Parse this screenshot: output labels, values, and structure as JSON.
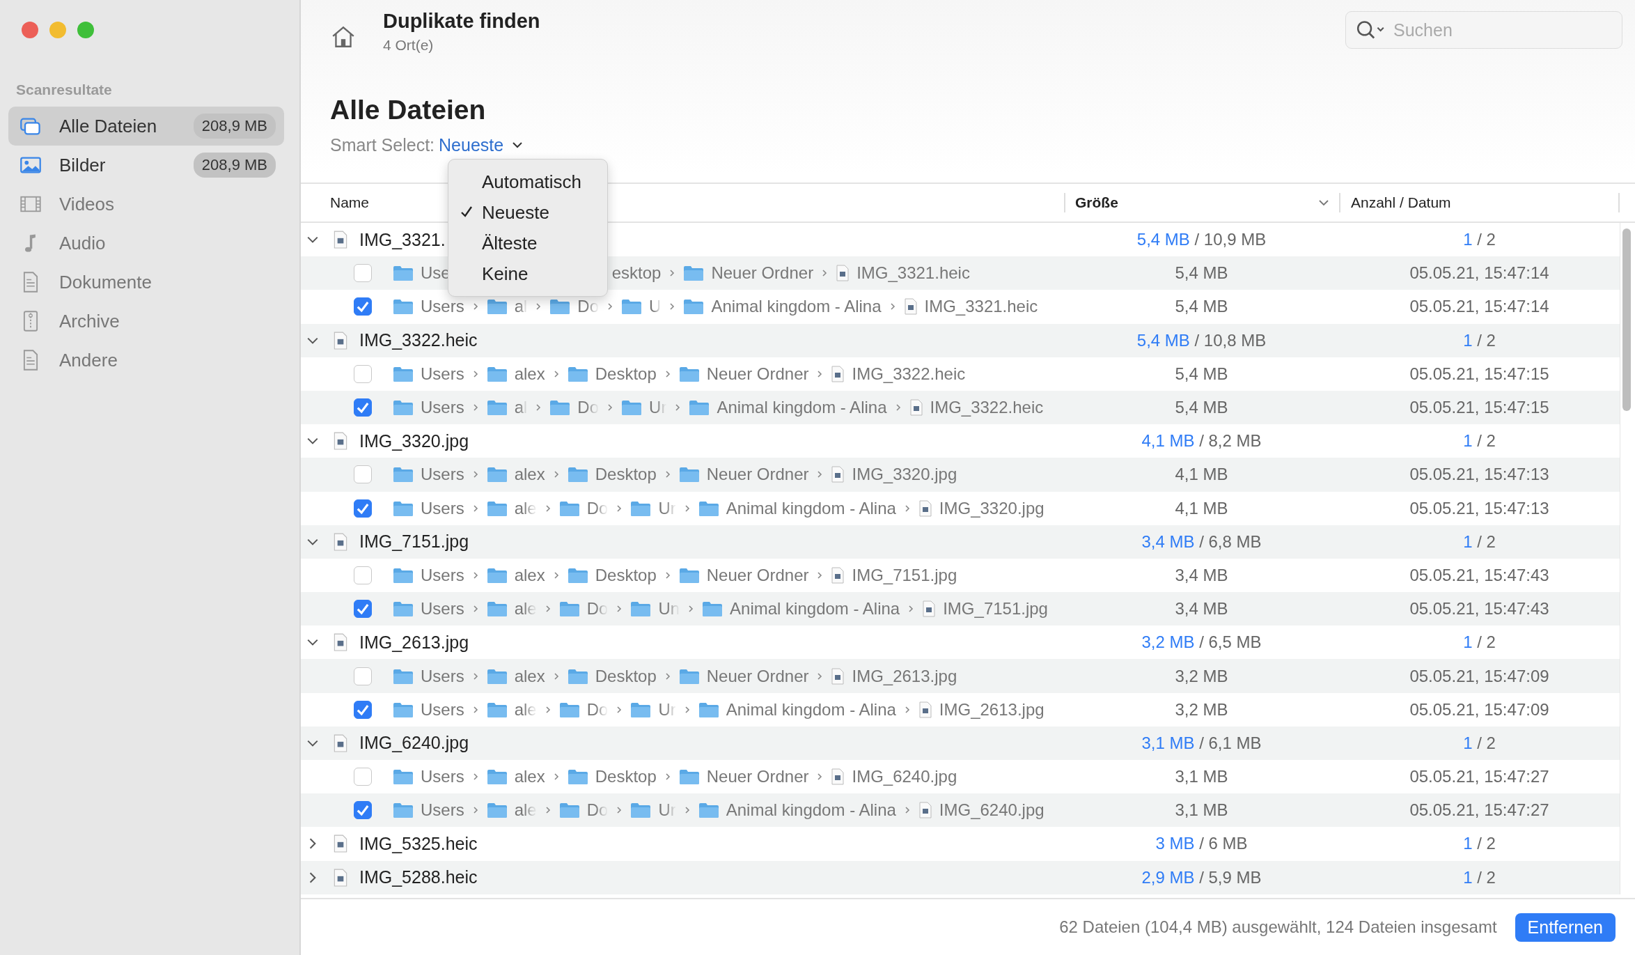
{
  "window": {
    "title": "Duplikate finden",
    "subtitle": "4 Ort(e)"
  },
  "search": {
    "placeholder": "Suchen"
  },
  "sidebar": {
    "section_title": "Scanresultate",
    "items": [
      {
        "label": "Alle Dateien",
        "badge": "208,9 MB",
        "selected": true,
        "disabled": false
      },
      {
        "label": "Bilder",
        "badge": "208,9 MB",
        "selected": false,
        "disabled": false
      },
      {
        "label": "Videos",
        "selected": false,
        "disabled": true
      },
      {
        "label": "Audio",
        "selected": false,
        "disabled": true
      },
      {
        "label": "Dokumente",
        "selected": false,
        "disabled": true
      },
      {
        "label": "Archive",
        "selected": false,
        "disabled": true
      },
      {
        "label": "Andere",
        "selected": false,
        "disabled": true
      }
    ]
  },
  "heading": "Alle Dateien",
  "smart_select": {
    "label": "Smart Select:",
    "value": "Neueste"
  },
  "menu": {
    "items": [
      {
        "label": "Automatisch",
        "selected": false
      },
      {
        "label": "Neueste",
        "selected": true
      },
      {
        "label": "Älteste",
        "selected": false
      },
      {
        "label": "Keine",
        "selected": false
      }
    ]
  },
  "table": {
    "columns": [
      "Name",
      "Größe",
      "Anzahl / Datum"
    ],
    "groups": [
      {
        "name": "IMG_3321.",
        "expanded": true,
        "size_selected": "5,4 MB",
        "size_total": "/ 10,9 MB",
        "count_selected": "1",
        "count_total": "/ 2",
        "files": [
          {
            "checked": false,
            "path": [
              {
                "text": "Use",
                "kind": "folder"
              },
              {
                "text": "esktop",
                "kind": "cut"
              },
              {
                "text": "Neuer Ordner",
                "kind": "folder"
              },
              {
                "text": "IMG_3321.heic",
                "kind": "file"
              }
            ],
            "size": "5,4 MB",
            "date": "05.05.21, 15:47:14"
          },
          {
            "checked": true,
            "path": [
              {
                "text": "Users",
                "kind": "folder"
              },
              {
                "text": "al",
                "kind": "truncated"
              },
              {
                "text": "Do",
                "kind": "truncated"
              },
              {
                "text": "U",
                "kind": "truncated"
              },
              {
                "text": "Animal kingdom - Alina",
                "kind": "folder"
              },
              {
                "text": "IMG_3321.heic",
                "kind": "file"
              }
            ],
            "size": "5,4 MB",
            "date": "05.05.21, 15:47:14"
          }
        ]
      },
      {
        "name": "IMG_3322.heic",
        "expanded": true,
        "size_selected": "5,4 MB",
        "size_total": "/ 10,8 MB",
        "count_selected": "1",
        "count_total": "/ 2",
        "files": [
          {
            "checked": false,
            "path": [
              {
                "text": "Users",
                "kind": "folder"
              },
              {
                "text": "alex",
                "kind": "folder"
              },
              {
                "text": "Desktop",
                "kind": "folder"
              },
              {
                "text": "Neuer Ordner",
                "kind": "folder"
              },
              {
                "text": "IMG_3322.heic",
                "kind": "file"
              }
            ],
            "size": "5,4 MB",
            "date": "05.05.21, 15:47:15"
          },
          {
            "checked": true,
            "path": [
              {
                "text": "Users",
                "kind": "folder"
              },
              {
                "text": "al",
                "kind": "truncated"
              },
              {
                "text": "Do",
                "kind": "truncated"
              },
              {
                "text": "Ur",
                "kind": "truncated"
              },
              {
                "text": "Animal kingdom - Alina",
                "kind": "folder"
              },
              {
                "text": "IMG_3322.heic",
                "kind": "file"
              }
            ],
            "size": "5,4 MB",
            "date": "05.05.21, 15:47:15"
          }
        ]
      },
      {
        "name": "IMG_3320.jpg",
        "expanded": true,
        "size_selected": "4,1 MB",
        "size_total": "/ 8,2 MB",
        "count_selected": "1",
        "count_total": "/ 2",
        "files": [
          {
            "checked": false,
            "path": [
              {
                "text": "Users",
                "kind": "folder"
              },
              {
                "text": "alex",
                "kind": "folder"
              },
              {
                "text": "Desktop",
                "kind": "folder"
              },
              {
                "text": "Neuer Ordner",
                "kind": "folder"
              },
              {
                "text": "IMG_3320.jpg",
                "kind": "file"
              }
            ],
            "size": "4,1 MB",
            "date": "05.05.21, 15:47:13"
          },
          {
            "checked": true,
            "path": [
              {
                "text": "Users",
                "kind": "folder"
              },
              {
                "text": "ale",
                "kind": "truncated"
              },
              {
                "text": "Do",
                "kind": "truncated"
              },
              {
                "text": "Ur",
                "kind": "truncated"
              },
              {
                "text": "Animal kingdom - Alina",
                "kind": "folder"
              },
              {
                "text": "IMG_3320.jpg",
                "kind": "file"
              }
            ],
            "size": "4,1 MB",
            "date": "05.05.21, 15:47:13"
          }
        ]
      },
      {
        "name": "IMG_7151.jpg",
        "expanded": true,
        "size_selected": "3,4 MB",
        "size_total": "/ 6,8 MB",
        "count_selected": "1",
        "count_total": "/ 2",
        "files": [
          {
            "checked": false,
            "path": [
              {
                "text": "Users",
                "kind": "folder"
              },
              {
                "text": "alex",
                "kind": "folder"
              },
              {
                "text": "Desktop",
                "kind": "folder"
              },
              {
                "text": "Neuer Ordner",
                "kind": "folder"
              },
              {
                "text": "IMG_7151.jpg",
                "kind": "file"
              }
            ],
            "size": "3,4 MB",
            "date": "05.05.21, 15:47:43"
          },
          {
            "checked": true,
            "path": [
              {
                "text": "Users",
                "kind": "folder"
              },
              {
                "text": "ale",
                "kind": "truncated"
              },
              {
                "text": "Do",
                "kind": "truncated"
              },
              {
                "text": "Un",
                "kind": "truncated"
              },
              {
                "text": "Animal kingdom - Alina",
                "kind": "folder"
              },
              {
                "text": "IMG_7151.jpg",
                "kind": "file"
              }
            ],
            "size": "3,4 MB",
            "date": "05.05.21, 15:47:43"
          }
        ]
      },
      {
        "name": "IMG_2613.jpg",
        "expanded": true,
        "size_selected": "3,2 MB",
        "size_total": "/ 6,5 MB",
        "count_selected": "1",
        "count_total": "/ 2",
        "files": [
          {
            "checked": false,
            "path": [
              {
                "text": "Users",
                "kind": "folder"
              },
              {
                "text": "alex",
                "kind": "folder"
              },
              {
                "text": "Desktop",
                "kind": "folder"
              },
              {
                "text": "Neuer Ordner",
                "kind": "folder"
              },
              {
                "text": "IMG_2613.jpg",
                "kind": "file"
              }
            ],
            "size": "3,2 MB",
            "date": "05.05.21, 15:47:09"
          },
          {
            "checked": true,
            "path": [
              {
                "text": "Users",
                "kind": "folder"
              },
              {
                "text": "ale",
                "kind": "truncated"
              },
              {
                "text": "Do",
                "kind": "truncated"
              },
              {
                "text": "Ur",
                "kind": "truncated"
              },
              {
                "text": "Animal kingdom - Alina",
                "kind": "folder"
              },
              {
                "text": "IMG_2613.jpg",
                "kind": "file"
              }
            ],
            "size": "3,2 MB",
            "date": "05.05.21, 15:47:09"
          }
        ]
      },
      {
        "name": "IMG_6240.jpg",
        "expanded": true,
        "size_selected": "3,1 MB",
        "size_total": "/ 6,1 MB",
        "count_selected": "1",
        "count_total": "/ 2",
        "files": [
          {
            "checked": false,
            "path": [
              {
                "text": "Users",
                "kind": "folder"
              },
              {
                "text": "alex",
                "kind": "folder"
              },
              {
                "text": "Desktop",
                "kind": "folder"
              },
              {
                "text": "Neuer Ordner",
                "kind": "folder"
              },
              {
                "text": "IMG_6240.jpg",
                "kind": "file"
              }
            ],
            "size": "3,1 MB",
            "date": "05.05.21, 15:47:27"
          },
          {
            "checked": true,
            "path": [
              {
                "text": "Users",
                "kind": "folder"
              },
              {
                "text": "ale",
                "kind": "truncated"
              },
              {
                "text": "Do",
                "kind": "truncated"
              },
              {
                "text": "Ur",
                "kind": "truncated"
              },
              {
                "text": "Animal kingdom - Alina",
                "kind": "folder"
              },
              {
                "text": "IMG_6240.jpg",
                "kind": "file"
              }
            ],
            "size": "3,1 MB",
            "date": "05.05.21, 15:47:27"
          }
        ]
      },
      {
        "name": "IMG_5325.heic",
        "expanded": false,
        "size_selected": "3 MB",
        "size_total": "/ 6 MB",
        "count_selected": "1",
        "count_total": "/ 2"
      },
      {
        "name": "IMG_5288.heic",
        "expanded": false,
        "size_selected": "2,9 MB",
        "size_total": "/ 5,9 MB",
        "count_selected": "1",
        "count_total": "/ 2"
      }
    ]
  },
  "status": "62 Dateien (104,4 MB) ausgewählt, 124 Dateien insgesamt",
  "buttons": [
    "Entfernen"
  ]
}
